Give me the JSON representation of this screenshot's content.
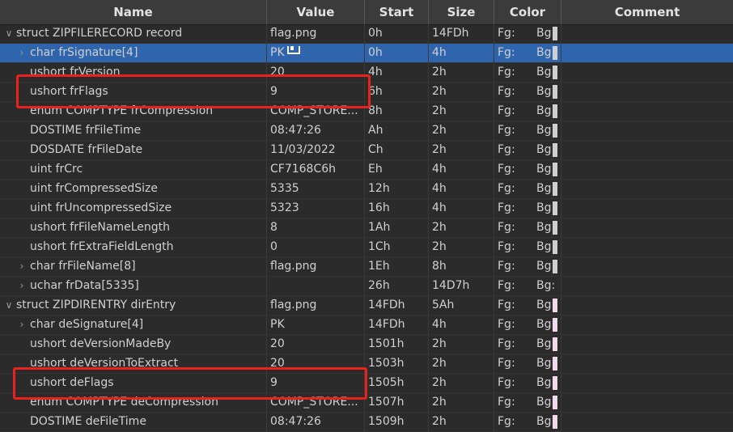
{
  "columns": {
    "name": "Name",
    "value": "Value",
    "start": "Start",
    "size": "Size",
    "color": "Color",
    "comment": "Comment"
  },
  "colors": {
    "selected_row": "#2f65ad",
    "swatch_record": "#cfcfcf",
    "swatch_dir": "#f0d8ef",
    "highlight": "#e8231e"
  },
  "rows": [
    {
      "arrow": "chevron-down-icon",
      "level": 0,
      "name": "struct ZIPFILERECORD record",
      "value": "flag.png",
      "start": "0h",
      "size": "14FDh",
      "fg": "Fg:",
      "bg": "Bg:",
      "swatch": "record",
      "comment": ""
    },
    {
      "arrow": "chevron-right-icon",
      "level": 1,
      "name": "char frSignature[4]",
      "value": "PK",
      "start": "0h",
      "size": "4h",
      "fg": "Fg:",
      "bg": "Bg:",
      "swatch": "record",
      "comment": "",
      "selected": true
    },
    {
      "arrow": "",
      "level": 1,
      "name": "ushort frVersion",
      "value": "20",
      "start": "4h",
      "size": "2h",
      "fg": "Fg:",
      "bg": "Bg:",
      "swatch": "record",
      "comment": ""
    },
    {
      "arrow": "",
      "level": 1,
      "name": "ushort frFlags",
      "value": "9",
      "start": "6h",
      "size": "2h",
      "fg": "Fg:",
      "bg": "Bg:",
      "swatch": "record",
      "comment": ""
    },
    {
      "arrow": "",
      "level": 1,
      "name": "enum COMPTYPE frCompression",
      "value": "COMP_STORE...",
      "start": "8h",
      "size": "2h",
      "fg": "Fg:",
      "bg": "Bg:",
      "swatch": "record",
      "comment": ""
    },
    {
      "arrow": "",
      "level": 1,
      "name": "DOSTIME frFileTime",
      "value": "08:47:26",
      "start": "Ah",
      "size": "2h",
      "fg": "Fg:",
      "bg": "Bg:",
      "swatch": "record",
      "comment": ""
    },
    {
      "arrow": "",
      "level": 1,
      "name": "DOSDATE frFileDate",
      "value": "11/03/2022",
      "start": "Ch",
      "size": "2h",
      "fg": "Fg:",
      "bg": "Bg:",
      "swatch": "record",
      "comment": ""
    },
    {
      "arrow": "",
      "level": 1,
      "name": "uint frCrc",
      "value": "CF7168C6h",
      "start": "Eh",
      "size": "4h",
      "fg": "Fg:",
      "bg": "Bg:",
      "swatch": "record",
      "comment": ""
    },
    {
      "arrow": "",
      "level": 1,
      "name": "uint frCompressedSize",
      "value": "5335",
      "start": "12h",
      "size": "4h",
      "fg": "Fg:",
      "bg": "Bg:",
      "swatch": "record",
      "comment": ""
    },
    {
      "arrow": "",
      "level": 1,
      "name": "uint frUncompressedSize",
      "value": "5323",
      "start": "16h",
      "size": "4h",
      "fg": "Fg:",
      "bg": "Bg:",
      "swatch": "record",
      "comment": ""
    },
    {
      "arrow": "",
      "level": 1,
      "name": "ushort frFileNameLength",
      "value": "8",
      "start": "1Ah",
      "size": "2h",
      "fg": "Fg:",
      "bg": "Bg:",
      "swatch": "record",
      "comment": ""
    },
    {
      "arrow": "",
      "level": 1,
      "name": "ushort frExtraFieldLength",
      "value": "0",
      "start": "1Ch",
      "size": "2h",
      "fg": "Fg:",
      "bg": "Bg:",
      "swatch": "record",
      "comment": ""
    },
    {
      "arrow": "chevron-right-icon",
      "level": 1,
      "name": "char frFileName[8]",
      "value": "flag.png",
      "start": "1Eh",
      "size": "8h",
      "fg": "Fg:",
      "bg": "Bg:",
      "swatch": "record",
      "comment": ""
    },
    {
      "arrow": "chevron-right-icon",
      "level": 1,
      "name": "uchar frData[5335]",
      "value": "",
      "start": "26h",
      "size": "14D7h",
      "fg": "Fg:",
      "bg": "Bg:",
      "swatch": "none",
      "comment": ""
    },
    {
      "arrow": "chevron-down-icon",
      "level": 0,
      "name": "struct ZIPDIRENTRY dirEntry",
      "value": "flag.png",
      "start": "14FDh",
      "size": "5Ah",
      "fg": "Fg:",
      "bg": "Bg:",
      "swatch": "dir",
      "comment": ""
    },
    {
      "arrow": "chevron-right-icon",
      "level": 1,
      "name": "char deSignature[4]",
      "value": "PK",
      "start": "14FDh",
      "size": "4h",
      "fg": "Fg:",
      "bg": "Bg:",
      "swatch": "dir",
      "comment": ""
    },
    {
      "arrow": "",
      "level": 1,
      "name": "ushort deVersionMadeBy",
      "value": "20",
      "start": "1501h",
      "size": "2h",
      "fg": "Fg:",
      "bg": "Bg:",
      "swatch": "dir",
      "comment": ""
    },
    {
      "arrow": "",
      "level": 1,
      "name": "ushort deVersionToExtract",
      "value": "20",
      "start": "1503h",
      "size": "2h",
      "fg": "Fg:",
      "bg": "Bg:",
      "swatch": "dir",
      "comment": ""
    },
    {
      "arrow": "",
      "level": 1,
      "name": "ushort deFlags",
      "value": "9",
      "start": "1505h",
      "size": "2h",
      "fg": "Fg:",
      "bg": "Bg:",
      "swatch": "dir",
      "comment": ""
    },
    {
      "arrow": "",
      "level": 1,
      "name": "enum COMPTYPE deCompression",
      "value": "COMP_STORE...",
      "start": "1507h",
      "size": "2h",
      "fg": "Fg:",
      "bg": "Bg:",
      "swatch": "dir",
      "comment": ""
    },
    {
      "arrow": "",
      "level": 1,
      "name": "DOSTIME deFileTime",
      "value": "08:47:26",
      "start": "1509h",
      "size": "2h",
      "fg": "Fg:",
      "bg": "Bg:",
      "swatch": "dir",
      "comment": ""
    }
  ]
}
